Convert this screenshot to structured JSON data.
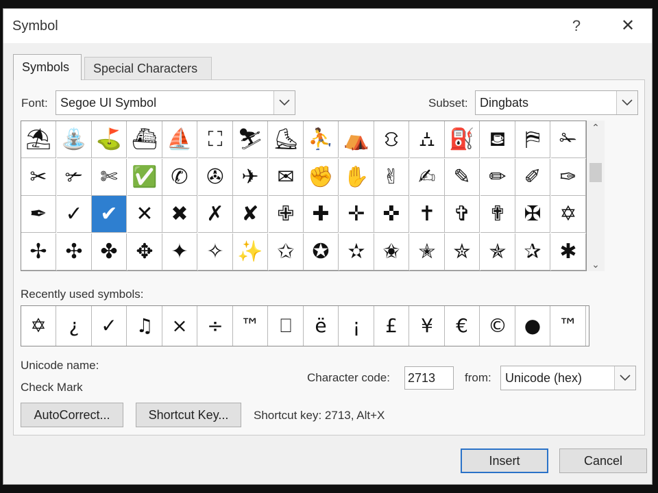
{
  "dialog": {
    "title": "Symbol",
    "help_label": "?",
    "close_label": "✕"
  },
  "tabs": [
    {
      "label": "Symbols",
      "active": true
    },
    {
      "label": "Special Characters",
      "active": false
    }
  ],
  "font": {
    "label": "Font:",
    "value": "Segoe UI Symbol"
  },
  "subset": {
    "label": "Subset:",
    "value": "Dingbats"
  },
  "symbol_grid": {
    "rows": [
      [
        "⛱",
        "⛲",
        "⛳",
        "⛴",
        "⛵",
        "⛶",
        "⛷",
        "⛸",
        "⛹",
        "⛺",
        "⛻",
        "⛼",
        "⛽",
        "⛾",
        "⛿",
        "✁"
      ],
      [
        "✂",
        "✃",
        "✄",
        "✅",
        "✆",
        "✇",
        "✈",
        "✉",
        "✊",
        "✋",
        "✌",
        "✍",
        "✎",
        "✏",
        "✐",
        "✑"
      ],
      [
        "✒",
        "✓",
        "✔",
        "✕",
        "✖",
        "✗",
        "✘",
        "✙",
        "✚",
        "✛",
        "✜",
        "✝",
        "✞",
        "✟",
        "✠",
        "✡"
      ],
      [
        "✢",
        "✣",
        "✤",
        "✥",
        "✦",
        "✧",
        "✨",
        "✩",
        "✪",
        "✫",
        "✬",
        "✭",
        "✮",
        "✯",
        "✰",
        "✱"
      ]
    ],
    "selected": {
      "row": 2,
      "col": 2
    }
  },
  "scrollbar": {
    "up": "⌃",
    "down": "⌄"
  },
  "recent": {
    "label": "Recently used symbols:",
    "symbols": [
      "✡",
      "¿",
      "✓",
      "♫",
      "×",
      "÷",
      "™",
      "⎕",
      "ë",
      "¡",
      "£",
      "¥",
      "€",
      "©",
      "●",
      "™"
    ]
  },
  "unicode_name": {
    "label": "Unicode name:",
    "value": "Check Mark"
  },
  "character_code": {
    "label": "Character code:",
    "value": "2713"
  },
  "from": {
    "label": "from:",
    "value": "Unicode (hex)"
  },
  "buttons": {
    "autocorrect": "AutoCorrect...",
    "shortcut_key": "Shortcut Key...",
    "insert": "Insert",
    "cancel": "Cancel"
  },
  "shortcut_text": "Shortcut key: 2713, Alt+X",
  "colors": {
    "selection": "#2e7fd0",
    "dialog_bg": "#f0f0f0",
    "default_button_border": "#2a72c8"
  }
}
